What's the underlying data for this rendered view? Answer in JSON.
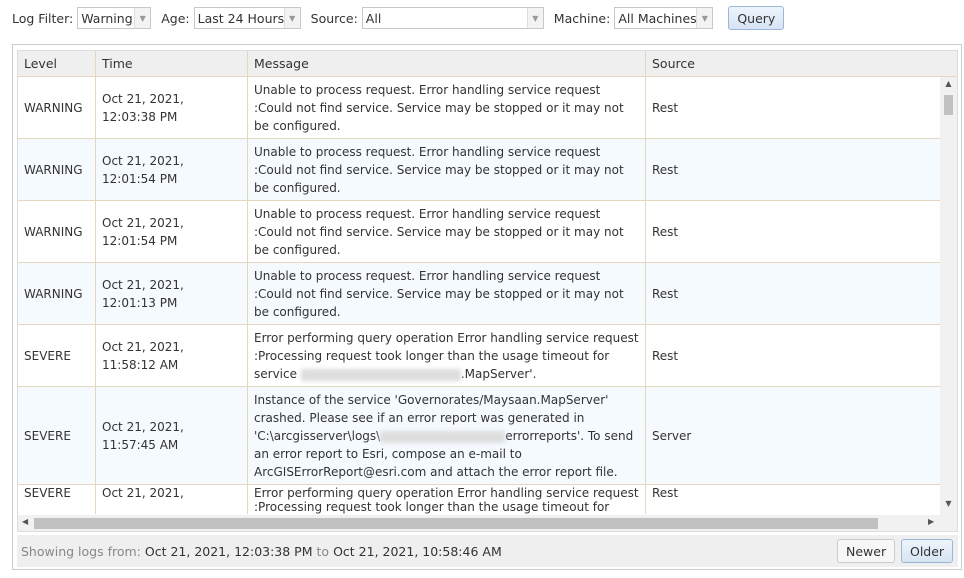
{
  "toolbar": {
    "log_filter_label": "Log Filter:",
    "log_filter_value": "Warning",
    "age_label": "Age:",
    "age_value": "Last 24 Hours",
    "source_label": "Source:",
    "source_value": "All",
    "machine_label": "Machine:",
    "machine_value": "All Machines",
    "query_label": "Query"
  },
  "table": {
    "headers": [
      "Level",
      "Time",
      "Message",
      "Source"
    ],
    "rows": [
      {
        "level": "WARNING",
        "time": "Oct 21, 2021, 12:03:38 PM",
        "message": "Unable to process request. Error handling service request :Could not find service. Service may be stopped or it may not be configured.",
        "source": "Rest"
      },
      {
        "level": "WARNING",
        "time": "Oct 21, 2021, 12:01:54 PM",
        "message": "Unable to process request. Error handling service request :Could not find service. Service may be stopped or it may not be configured.",
        "source": "Rest"
      },
      {
        "level": "WARNING",
        "time": "Oct 21, 2021, 12:01:54 PM",
        "message": "Unable to process request. Error handling service request :Could not find service. Service may be stopped or it may not be configured.",
        "source": "Rest"
      },
      {
        "level": "WARNING",
        "time": "Oct 21, 2021, 12:01:13 PM",
        "message": "Unable to process request. Error handling service request :Could not find service. Service may be stopped or it may not be configured.",
        "source": "Rest"
      },
      {
        "level": "SEVERE",
        "time": "Oct 21, 2021, 11:58:12 AM",
        "message_a": "Error performing query operation Error handling service request :Processing request took longer than the usage timeout for service ",
        "message_b": ".MapServer'.",
        "source": "Rest"
      },
      {
        "level": "SEVERE",
        "time": "Oct 21, 2021, 11:57:45 AM",
        "message_a": "Instance of the service 'Governorates/Maysaan.MapServer' crashed. Please see if an error report was generated in 'C:\\arcgisserver\\logs\\",
        "message_b": "errorreports'. To send an error report to Esri, compose an e-mail to ArcGISErrorReport@esri.com and attach the error report file.",
        "source": "Server"
      },
      {
        "level": "SEVERE",
        "time": "Oct 21, 2021,",
        "message": "Error performing query operation Error handling service request :Processing request took longer than the usage timeout for",
        "source": "Rest"
      }
    ]
  },
  "footer": {
    "showing_label": "Showing logs from:",
    "from": "Oct 21, 2021, 12:03:38 PM",
    "to_label": "to",
    "to": "Oct 21, 2021, 10:58:46 AM",
    "newer_label": "Newer",
    "older_label": "Older"
  }
}
